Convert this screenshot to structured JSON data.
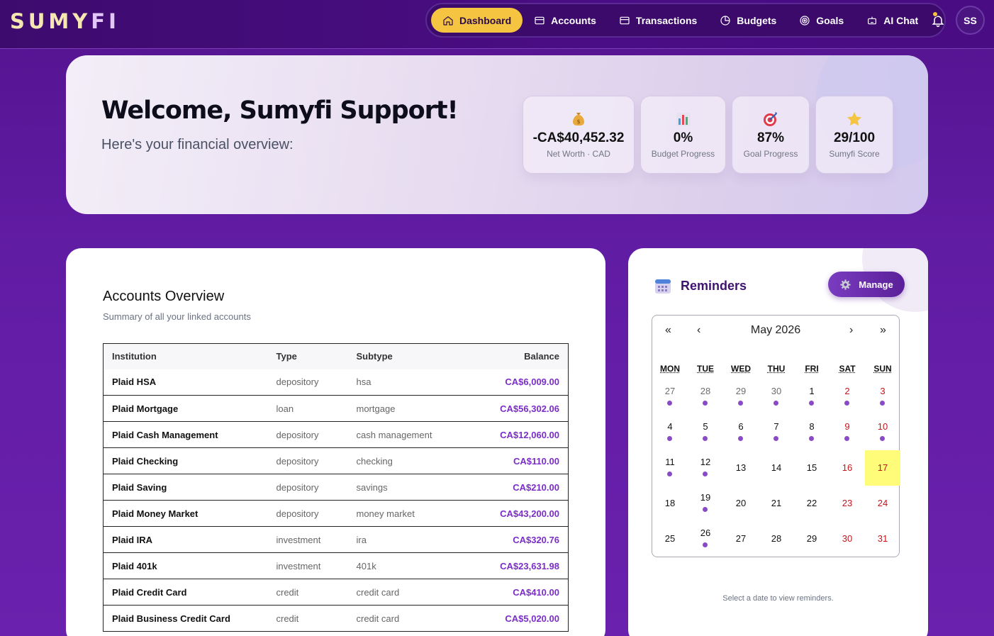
{
  "app": {
    "logo_main": "SUMY",
    "logo_accent": "FI",
    "avatar_initials": "SS"
  },
  "nav": {
    "items": [
      {
        "label": "Dashboard",
        "icon": "home-icon",
        "active": true
      },
      {
        "label": "Accounts",
        "icon": "card-icon",
        "active": false
      },
      {
        "label": "Transactions",
        "icon": "card-icon",
        "active": false
      },
      {
        "label": "Budgets",
        "icon": "pie-icon",
        "active": false
      },
      {
        "label": "Goals",
        "icon": "target-icon",
        "active": false
      },
      {
        "label": "AI Chat",
        "icon": "robot-icon",
        "active": false
      }
    ],
    "notification_icon": "bell-icon"
  },
  "hero": {
    "title": "Welcome, Sumyfi Support!",
    "subtitle": "Here's your financial overview:",
    "stats": [
      {
        "icon": "money-bag-icon",
        "value": "-CA$40,452.32",
        "label": "Net Worth · CAD"
      },
      {
        "icon": "bar-chart-icon",
        "value": "0%",
        "label": "Budget Progress"
      },
      {
        "icon": "target-icon",
        "value": "87%",
        "label": "Goal Progress"
      },
      {
        "icon": "star-icon",
        "value": "29/100",
        "label": "Sumyfi Score"
      }
    ]
  },
  "accounts": {
    "title": "Accounts Overview",
    "description": "Summary of all your linked accounts",
    "columns": {
      "institution": "Institution",
      "type": "Type",
      "subtype": "Subtype",
      "balance": "Balance"
    },
    "rows": [
      {
        "institution": "Plaid HSA",
        "type": "depository",
        "subtype": "hsa",
        "balance": "CA$6,009.00"
      },
      {
        "institution": "Plaid Mortgage",
        "type": "loan",
        "subtype": "mortgage",
        "balance": "CA$56,302.06"
      },
      {
        "institution": "Plaid Cash Management",
        "type": "depository",
        "subtype": "cash management",
        "balance": "CA$12,060.00"
      },
      {
        "institution": "Plaid Checking",
        "type": "depository",
        "subtype": "checking",
        "balance": "CA$110.00"
      },
      {
        "institution": "Plaid Saving",
        "type": "depository",
        "subtype": "savings",
        "balance": "CA$210.00"
      },
      {
        "institution": "Plaid Money Market",
        "type": "depository",
        "subtype": "money market",
        "balance": "CA$43,200.00"
      },
      {
        "institution": "Plaid IRA",
        "type": "investment",
        "subtype": "ira",
        "balance": "CA$320.76"
      },
      {
        "institution": "Plaid 401k",
        "type": "investment",
        "subtype": "401k",
        "balance": "CA$23,631.98"
      },
      {
        "institution": "Plaid Credit Card",
        "type": "credit",
        "subtype": "credit card",
        "balance": "CA$410.00"
      },
      {
        "institution": "Plaid Business Credit Card",
        "type": "credit",
        "subtype": "credit card",
        "balance": "CA$5,020.00"
      }
    ]
  },
  "reminders": {
    "title": "Reminders",
    "manage_label": "Manage",
    "hint": "Select a date to view reminders.",
    "calendar": {
      "month_label": "May 2026",
      "prev_year": "«",
      "prev_month": "‹",
      "next_month": "›",
      "next_year": "»",
      "weekdays": [
        "MON",
        "TUE",
        "WED",
        "THU",
        "FRI",
        "SAT",
        "SUN"
      ],
      "weeks": [
        [
          {
            "d": "27",
            "muted": true,
            "ev": true
          },
          {
            "d": "28",
            "muted": true,
            "ev": true
          },
          {
            "d": "29",
            "muted": true,
            "ev": true
          },
          {
            "d": "30",
            "muted": true,
            "ev": true
          },
          {
            "d": "1",
            "ev": true
          },
          {
            "d": "2",
            "ev": true,
            "we": true
          },
          {
            "d": "3",
            "ev": true,
            "we": true
          }
        ],
        [
          {
            "d": "4",
            "ev": true
          },
          {
            "d": "5",
            "ev": true
          },
          {
            "d": "6",
            "ev": true
          },
          {
            "d": "7",
            "ev": true
          },
          {
            "d": "8",
            "ev": true
          },
          {
            "d": "9",
            "ev": true,
            "we": true
          },
          {
            "d": "10",
            "ev": true,
            "we": true
          }
        ],
        [
          {
            "d": "11",
            "ev": true
          },
          {
            "d": "12",
            "ev": true
          },
          {
            "d": "13"
          },
          {
            "d": "14"
          },
          {
            "d": "15"
          },
          {
            "d": "16",
            "we": true
          },
          {
            "d": "17",
            "we": true,
            "today": true
          }
        ],
        [
          {
            "d": "18"
          },
          {
            "d": "19",
            "ev": true
          },
          {
            "d": "20"
          },
          {
            "d": "21"
          },
          {
            "d": "22"
          },
          {
            "d": "23",
            "we": true
          },
          {
            "d": "24",
            "we": true
          }
        ],
        [
          {
            "d": "25"
          },
          {
            "d": "26",
            "ev": true
          },
          {
            "d": "27"
          },
          {
            "d": "28"
          },
          {
            "d": "29"
          },
          {
            "d": "30",
            "we": true
          },
          {
            "d": "31",
            "we": true
          }
        ]
      ]
    }
  },
  "colors": {
    "accent_yellow": "#f5c542",
    "brand_purple": "#54138f",
    "balance_purple": "#7b2ec7",
    "weekend_red": "#c4141c",
    "today_highlight": "#fffc7a"
  }
}
